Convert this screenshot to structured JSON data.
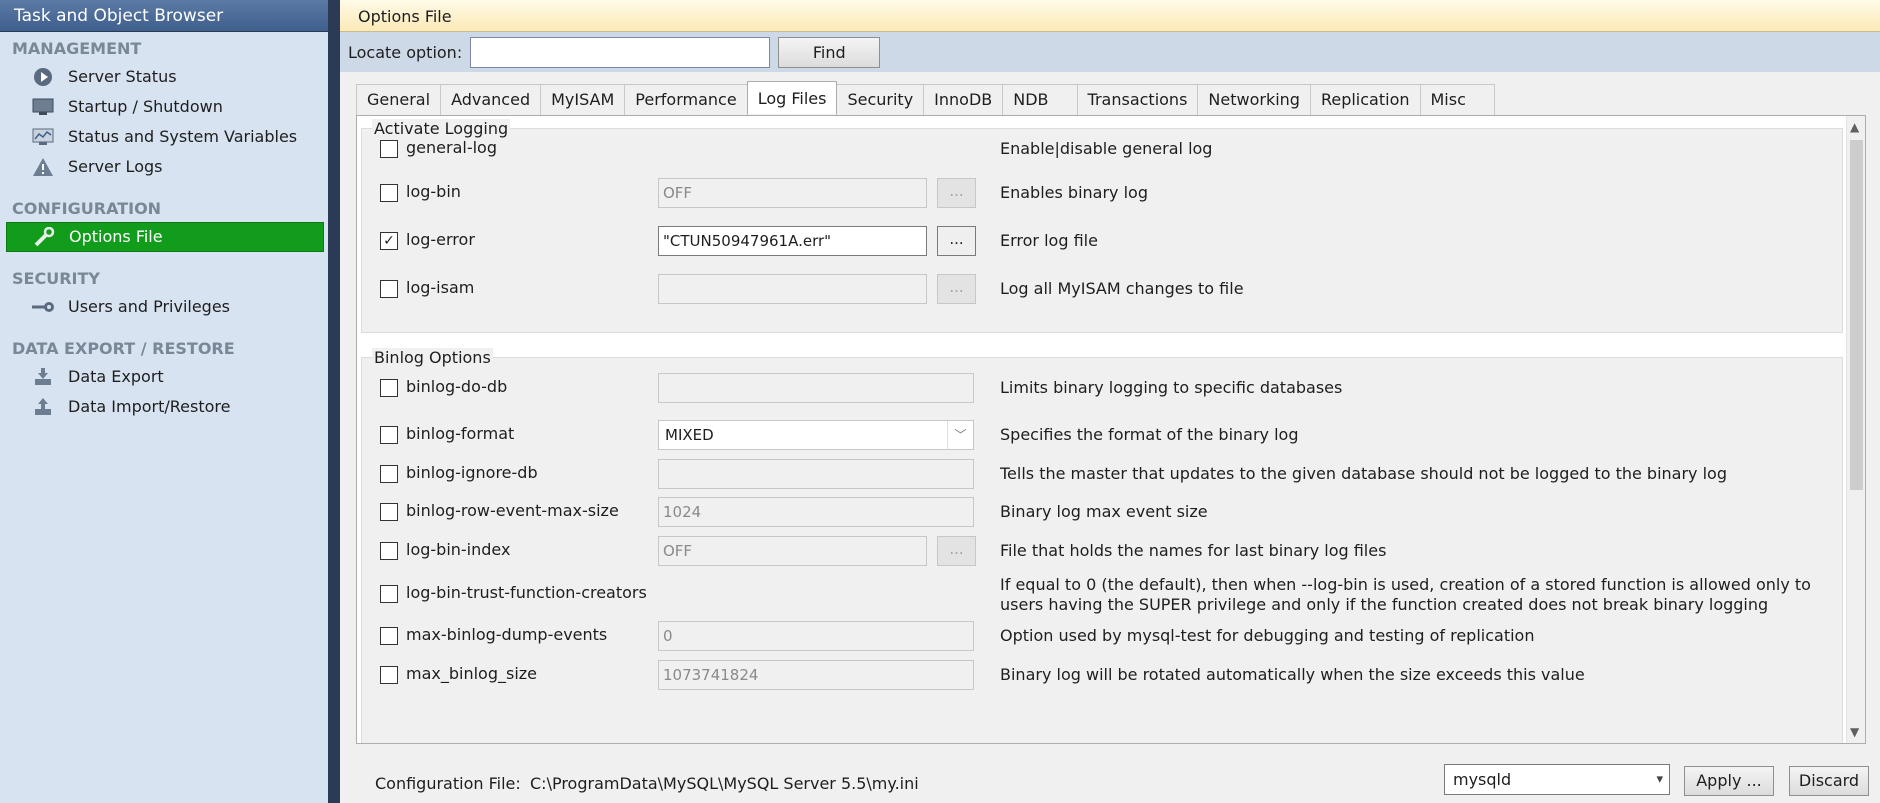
{
  "left_panel": {
    "title": "Task and Object Browser",
    "sections": [
      {
        "heading": "MANAGEMENT",
        "items": [
          "Server Status",
          "Startup / Shutdown",
          "Status and System Variables",
          "Server Logs"
        ]
      },
      {
        "heading": "CONFIGURATION",
        "items": [
          "Options File"
        ]
      },
      {
        "heading": "SECURITY",
        "items": [
          "Users and Privileges"
        ]
      },
      {
        "heading": "DATA EXPORT / RESTORE",
        "items": [
          "Data Export",
          "Data Import/Restore"
        ]
      }
    ],
    "active_item": "Options File"
  },
  "main": {
    "title": "Options File",
    "locate": {
      "label": "Locate option:",
      "value": "",
      "find_label": "Find"
    },
    "tabs": [
      "General",
      "Advanced",
      "MyISAM",
      "Performance",
      "Log Files",
      "Security",
      "InnoDB",
      "NDB",
      "Transactions",
      "Networking",
      "Replication",
      "Misc"
    ],
    "active_tab": "Log Files",
    "activate_logging": {
      "label": "Activate Logging",
      "options": [
        {
          "name": "general-log",
          "checked": false,
          "value": null,
          "description": "Enable|disable general log"
        },
        {
          "name": "log-bin",
          "checked": false,
          "value": "OFF",
          "browse": "...",
          "description": "Enables binary log"
        },
        {
          "name": "log-error",
          "checked": true,
          "value": "\"CTUN50947961A.err\"",
          "browse": "...",
          "description": "Error log file"
        },
        {
          "name": "log-isam",
          "checked": false,
          "value": "",
          "browse": "...",
          "description": "Log all MyISAM changes to file"
        }
      ]
    },
    "binlog_options": {
      "label": "Binlog Options",
      "options": [
        {
          "name": "binlog-do-db",
          "checked": false,
          "value": "",
          "description": "Limits binary logging to specific databases"
        },
        {
          "name": "binlog-format",
          "checked": false,
          "value": "MIXED",
          "description": "Specifies the format of the binary log"
        },
        {
          "name": "binlog-ignore-db",
          "checked": false,
          "value": "",
          "description": "Tells the master that updates to the given database should not be logged to the binary log"
        },
        {
          "name": "binlog-row-event-max-size",
          "checked": false,
          "value": "1024",
          "description": "Binary log max event size"
        },
        {
          "name": "log-bin-index",
          "checked": false,
          "value": "OFF",
          "browse": "...",
          "description": "File that holds the names for last binary log files"
        },
        {
          "name": "log-bin-trust-function-creators",
          "checked": false,
          "value": null,
          "description": "If equal to 0 (the default), then when --log-bin is used, creation of a stored function is allowed only to users having the SUPER privilege and only if the function created does not break binary logging"
        },
        {
          "name": "max-binlog-dump-events",
          "checked": false,
          "value": "0",
          "description": "Option used by mysql-test for debugging and testing of replication"
        },
        {
          "name": "max_binlog_size",
          "checked": false,
          "value": "1073741824",
          "description": "Binary log will be rotated automatically when the size exceeds this value"
        }
      ]
    },
    "footer": {
      "config_label": "Configuration File:",
      "config_path": "C:\\ProgramData\\MySQL\\MySQL Server 5.5\\my.ini",
      "section": "mysqld",
      "apply_label": "Apply ...",
      "discard_label": "Discard"
    }
  }
}
